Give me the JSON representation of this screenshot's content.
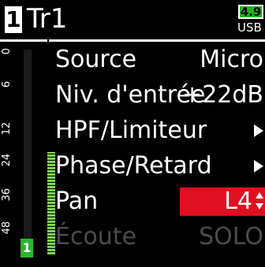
{
  "header": {
    "track_number": "1",
    "track_name": "Tr1",
    "battery_value": "4.9",
    "power_source": "USB"
  },
  "meter": {
    "scale_labels": [
      "0",
      "6",
      "12",
      "24",
      "36",
      "48"
    ],
    "channel": "1",
    "level_fraction": 0.5
  },
  "menu": {
    "source_label": "Source",
    "source_value": "Micro",
    "input_level_label": "Niv. d'entrée",
    "input_level_value": "+22dB",
    "hpf_label": "HPF/Limiteur",
    "phase_label": "Phase/Retard",
    "pan_label": "Pan",
    "pan_value": "L4",
    "monitor_label": "Écoute",
    "monitor_value": "SOLO"
  },
  "colors": {
    "selected": "#e01020",
    "battery": "#1fb21f",
    "meter": "#7fd455"
  }
}
